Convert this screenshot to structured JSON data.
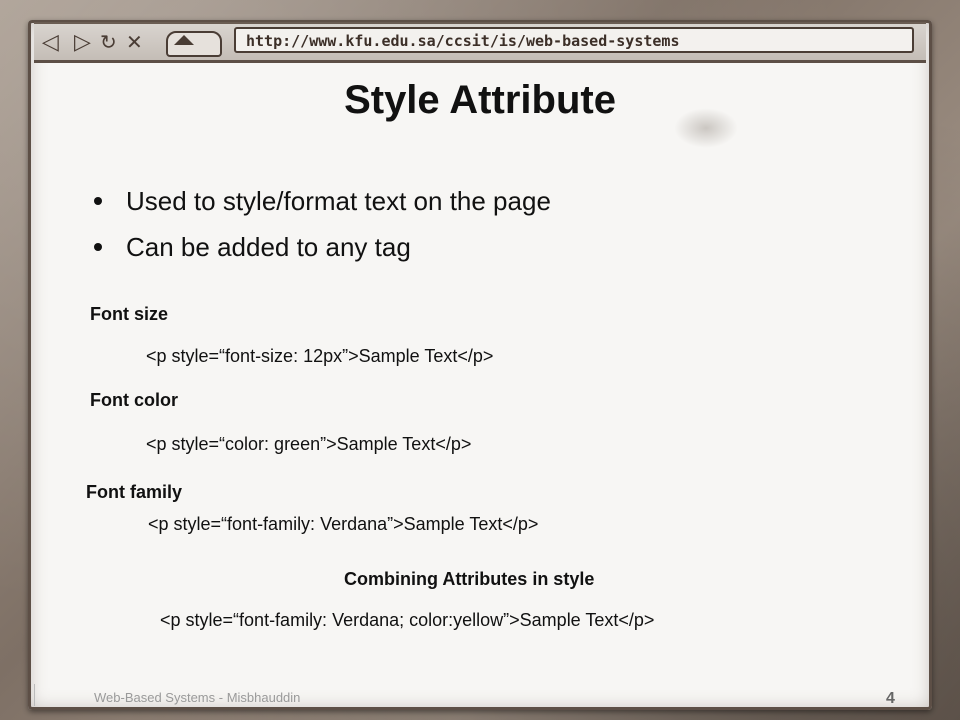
{
  "browser": {
    "url": "http://www.kfu.edu.sa/ccsit/is/web-based-systems",
    "icons": [
      "back-arrow",
      "forward-arrow",
      "reload",
      "stop",
      "home"
    ]
  },
  "slide": {
    "title": "Style Attribute",
    "bullets": [
      "Used to style/format text on the page",
      "Can be added to any tag"
    ],
    "sections": [
      {
        "label": "Font size",
        "code": "<p style=“font-size: 12px”>Sample Text</p>"
      },
      {
        "label": "Font color",
        "code": "<p style=“color: green”>Sample Text</p>"
      },
      {
        "label": "Font family",
        "code": "<p style=“font-family: Verdana”>Sample Text</p>"
      },
      {
        "label": "Combining Attributes in style",
        "code": "<p style=“font-family: Verdana; color:yellow”>Sample Text</p>"
      }
    ],
    "footer": "Web-Based Systems - Misbhauddin",
    "page_number": "4"
  },
  "colors": {
    "frame": "#8f8276",
    "border": "#5d4f46",
    "sheet": "#f7f6f4"
  }
}
